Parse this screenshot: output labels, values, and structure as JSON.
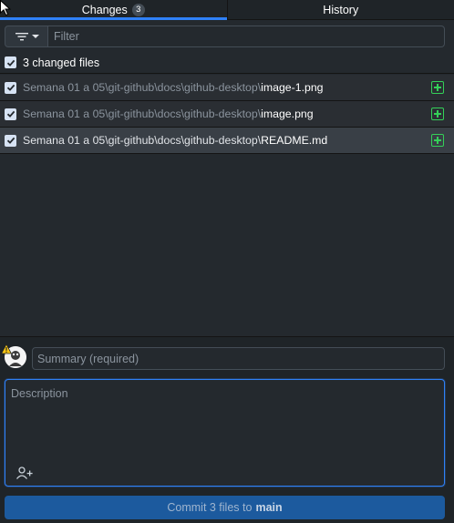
{
  "tabs": [
    {
      "label": "Changes",
      "badge": "3",
      "selected": true
    },
    {
      "label": "History",
      "selected": false
    }
  ],
  "filter": {
    "placeholder": "Filter",
    "value": ""
  },
  "changes": {
    "header_label": "3 changed files",
    "files": [
      {
        "dir": "Semana 01 a 05\\git-github\\docs\\github-desktop\\",
        "name": "image-1.png",
        "status": "added",
        "checked": true
      },
      {
        "dir": "Semana 01 a 05\\git-github\\docs\\github-desktop\\",
        "name": "image.png",
        "status": "added",
        "checked": true
      },
      {
        "dir": "Semana 01 a 05\\git-github\\docs\\github-desktop\\",
        "name": "README.md",
        "status": "added",
        "checked": true,
        "selected": true
      }
    ]
  },
  "commit": {
    "summary_placeholder": "Summary (required)",
    "description_placeholder": "Description",
    "button_prefix": "Commit 3 files to",
    "branch": "main"
  },
  "colors": {
    "accent": "#2f81f7",
    "added": "#34d058",
    "commit_button": "#1c5a9e"
  },
  "icons": [
    "filter-icon",
    "checkbox-check-icon",
    "file-added-icon",
    "warning-icon",
    "avatar",
    "add-coauthor-icon",
    "cursor-icon"
  ]
}
